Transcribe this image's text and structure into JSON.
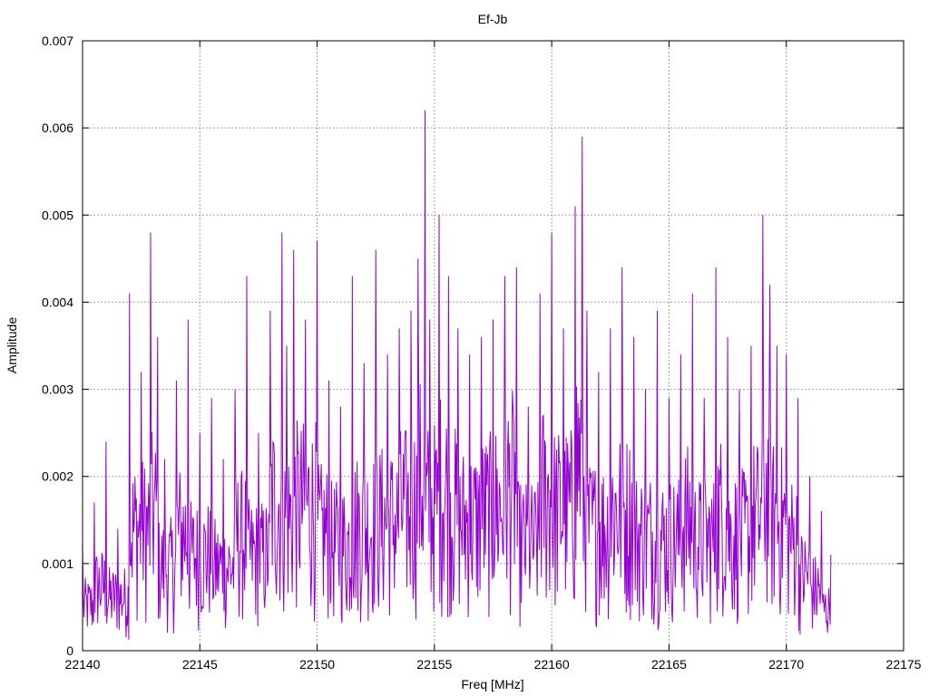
{
  "chart_data": {
    "type": "line",
    "title": "Ef-Jb",
    "xlabel": "Freq [MHz]",
    "ylabel": "Amplitude",
    "xlim": [
      22140,
      22175
    ],
    "ylim": [
      0,
      0.007
    ],
    "xticks": [
      22140,
      22145,
      22150,
      22155,
      22160,
      22165,
      22170,
      22175
    ],
    "xtick_labels": [
      "22140",
      "22145",
      "22150",
      "22155",
      "22160",
      "22165",
      "22170",
      "22175"
    ],
    "yticks": [
      0,
      0.001,
      0.002,
      0.003,
      0.004,
      0.005,
      0.006,
      0.007
    ],
    "ytick_labels": [
      "0",
      "0.001",
      "0.002",
      "0.003",
      "0.004",
      "0.005",
      "0.006",
      "0.007"
    ],
    "grid": true,
    "legend": "none",
    "color": "#9400d3",
    "series": [
      {
        "x": [
          22140.0,
          22140.5,
          22141.0,
          22141.5,
          22142.0,
          22142.5,
          22142.9,
          22143.2,
          22143.5,
          22144.0,
          22144.5,
          22145.0,
          22145.5,
          22146.0,
          22146.5,
          22147.0,
          22147.5,
          22148.0,
          22148.5,
          22148.7,
          22149.0,
          22149.5,
          22150.0,
          22150.5,
          22151.0,
          22151.5,
          22152.0,
          22152.5,
          22153.0,
          22153.5,
          22154.0,
          22154.3,
          22154.6,
          22154.8,
          22155.2,
          22155.6,
          22156.0,
          22156.5,
          22157.0,
          22157.5,
          22158.0,
          22158.5,
          22159.0,
          22159.5,
          22160.0,
          22160.5,
          22161.0,
          22161.3,
          22161.5,
          22162.0,
          22162.5,
          22163.0,
          22163.5,
          22164.0,
          22164.5,
          22165.0,
          22165.5,
          22166.0,
          22166.5,
          22167.0,
          22167.5,
          22168.0,
          22168.5,
          22169.0,
          22169.3,
          22169.6,
          22170.0,
          22170.5,
          22171.0,
          22171.5,
          22171.9
        ],
        "y": [
          0.0012,
          0.0017,
          0.0024,
          0.0014,
          0.0041,
          0.0032,
          0.0048,
          0.0036,
          0.0022,
          0.0031,
          0.0038,
          0.0025,
          0.0029,
          0.0022,
          0.003,
          0.0043,
          0.0025,
          0.0039,
          0.0048,
          0.0035,
          0.0046,
          0.0038,
          0.0047,
          0.0031,
          0.0028,
          0.0043,
          0.0033,
          0.0046,
          0.0034,
          0.0037,
          0.0039,
          0.0045,
          0.0062,
          0.0038,
          0.005,
          0.0043,
          0.0037,
          0.0034,
          0.0036,
          0.0038,
          0.0043,
          0.0044,
          0.0028,
          0.0041,
          0.0048,
          0.0037,
          0.0051,
          0.0059,
          0.0039,
          0.0032,
          0.0037,
          0.0044,
          0.0036,
          0.003,
          0.0039,
          0.0029,
          0.0034,
          0.0041,
          0.0029,
          0.0044,
          0.0036,
          0.003,
          0.0035,
          0.005,
          0.0042,
          0.0035,
          0.0034,
          0.0029,
          0.002,
          0.0016,
          0.0011
        ]
      }
    ]
  }
}
